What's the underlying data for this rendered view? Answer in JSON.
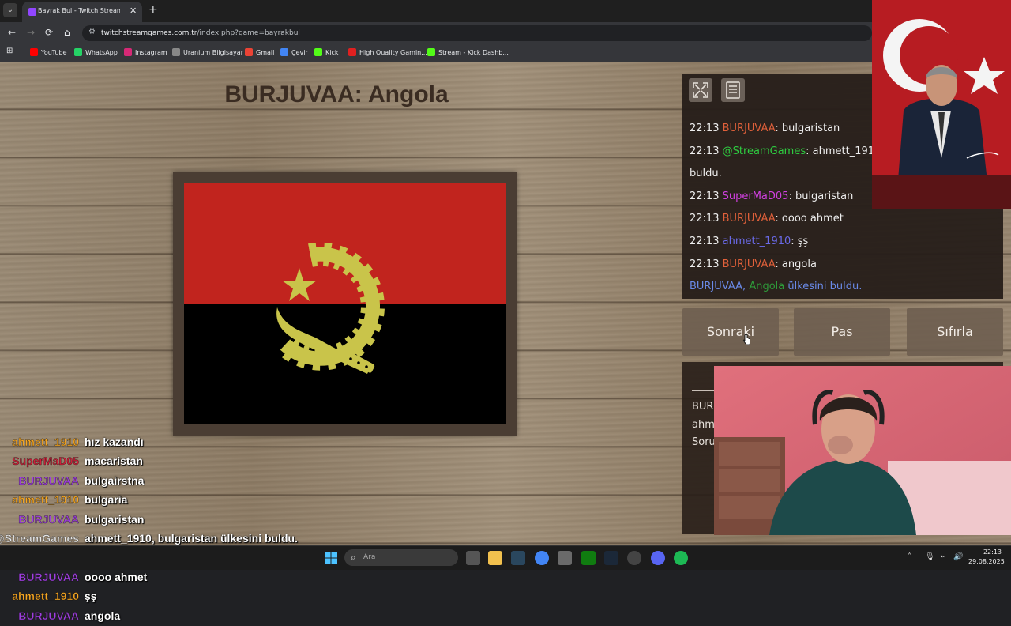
{
  "browser": {
    "tab_title": "Bayrak Bul - Twitch Stream",
    "tab_close": "✕",
    "new_tab": "+",
    "url_host": "twitchstreamgames.com.tr",
    "url_path": "/index.php?game=bayrakbul",
    "bookmarks": [
      {
        "label": "YouTube",
        "color": "#ff0000"
      },
      {
        "label": "WhatsApp",
        "color": "#25d366"
      },
      {
        "label": "Instagram",
        "color": "#d62976"
      },
      {
        "label": "Uranium Bilgisayar",
        "color": "#888888"
      },
      {
        "label": "Gmail",
        "color": "#ea4335"
      },
      {
        "label": "Çevir",
        "color": "#4285f4"
      },
      {
        "label": "Kick",
        "color": "#53fc18"
      },
      {
        "label": "High Quality Gamin...",
        "color": "#e02020"
      },
      {
        "label": "Stream - Kick Dashb...",
        "color": "#53fc18"
      }
    ]
  },
  "game": {
    "title": "BURJUVAA: Angola",
    "buttons": {
      "next": "Sonraki",
      "pass": "Pas",
      "reset": "Sıfırla"
    }
  },
  "chat": [
    {
      "time": "22:13",
      "user": "BURJUVAA",
      "user_class": "c-user1",
      "sep": ": ",
      "msg": "bulgaristan"
    },
    {
      "time": "22:13",
      "user": "@StreamGames",
      "user_class": "c-user2",
      "sep": ": ",
      "msg": "ahmett_1910,"
    },
    {
      "time": "",
      "user": "",
      "user_class": "",
      "sep": "",
      "msg": "buldu."
    },
    {
      "time": "22:13",
      "user": "SuperMaD05",
      "user_class": "c-user3",
      "sep": ": ",
      "msg": "bulgaristan"
    },
    {
      "time": "22:13",
      "user": "BURJUVAA",
      "user_class": "c-user1",
      "sep": ": ",
      "msg": "oooo ahmet"
    },
    {
      "time": "22:13",
      "user": "ahmett_1910",
      "user_class": "c-user4",
      "sep": ": ",
      "msg": "şş"
    },
    {
      "time": "22:13",
      "user": "BURJUVAA",
      "user_class": "c-user1",
      "sep": ": ",
      "msg": "angola"
    }
  ],
  "chat_result": {
    "user": "BURJUVAA,",
    "country": "Angola",
    "suffix": "ülkesini buldu."
  },
  "lower_panel": {
    "lines": [
      "BUR",
      "ahm",
      "Soru"
    ]
  },
  "overlay_chat": [
    {
      "user": "ahmett_1910",
      "color": "#f5a623",
      "msg": "hız kazandı"
    },
    {
      "user": "SuperMaD05",
      "color": "#d0203a",
      "msg": "macaristan"
    },
    {
      "user": "BURJUVAA",
      "color": "#a040e0",
      "msg": "bulgairstna"
    },
    {
      "user": "ahmett_1910",
      "color": "#f5a623",
      "msg": "bulgaria"
    },
    {
      "user": "BURJUVAA",
      "color": "#a040e0",
      "msg": "bulgaristan"
    },
    {
      "user": "@StreamGames",
      "color": "#e8e8e8",
      "msg": "ahmett_1910, bulgaristan ülkesini buldu."
    },
    {
      "user": "SuperMaD05",
      "color": "#d0203a",
      "msg": "bulgaristan"
    },
    {
      "user": "BURJUVAA",
      "color": "#a040e0",
      "msg": "oooo ahmet"
    },
    {
      "user": "ahmett_1910",
      "color": "#f5a623",
      "msg": "şş"
    },
    {
      "user": "BURJUVAA",
      "color": "#a040e0",
      "msg": "angola"
    }
  ],
  "taskbar": {
    "search_placeholder": "Ara",
    "time": "22:13",
    "date": "29.08.2025"
  },
  "colors": {
    "flag_red": "#c1241e",
    "flag_black": "#000000",
    "emblem_yellow": "#c9c44a"
  }
}
